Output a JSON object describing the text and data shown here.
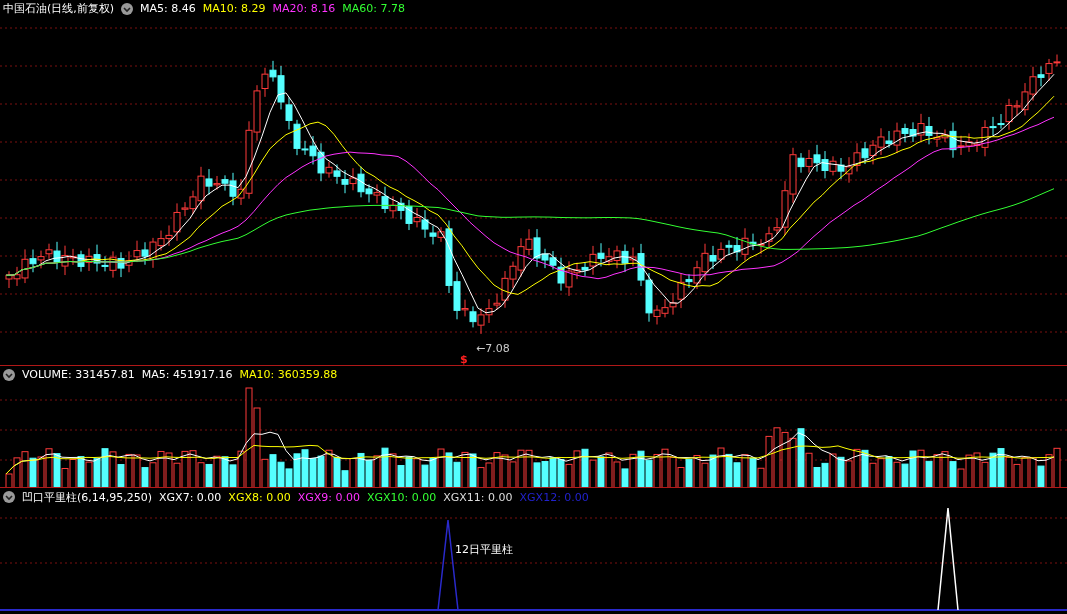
{
  "price_panel": {
    "title": "中国石油(日线,前复权)",
    "indicators": [
      {
        "label": "MA5: 8.46",
        "color": "#ffffff"
      },
      {
        "label": "MA10: 8.29",
        "color": "#ffff00"
      },
      {
        "label": "MA20: 8.16",
        "color": "#ff33ff"
      },
      {
        "label": "MA60: 7.78",
        "color": "#33ff33"
      }
    ],
    "low_label": "←7.08",
    "marker": "$"
  },
  "volume_panel": {
    "indicators": [
      {
        "label": "VOLUME: 331457.81",
        "color": "#ffffff"
      },
      {
        "label": "MA5: 451917.16",
        "color": "#ffffff"
      },
      {
        "label": "MA10: 360359.88",
        "color": "#ffff00"
      }
    ]
  },
  "indicator_panel": {
    "title": "凹口平里柱(6,14,95,250)",
    "indicators": [
      {
        "label": "XGX7: 0.00",
        "color": "#ffffff"
      },
      {
        "label": "XGX8: 0.00",
        "color": "#ffff00"
      },
      {
        "label": "XGX9: 0.00",
        "color": "#ff33ff"
      },
      {
        "label": "XGX10: 0.00",
        "color": "#33ff33"
      },
      {
        "label": "XGX11: 0.00",
        "color": "#dddddd"
      },
      {
        "label": "XGX12: 0.00",
        "color": "#2222cc"
      }
    ],
    "signal_label": "12日平里柱"
  }
}
